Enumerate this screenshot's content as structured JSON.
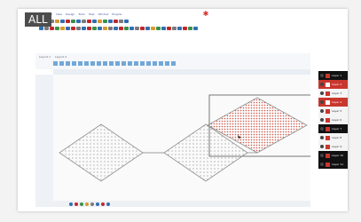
{
  "tag_label": "ALL",
  "brand_icon": "butterfly-logo-icon",
  "menu_items": [
    "File",
    "Edit",
    "View",
    "Design",
    "Tools",
    "Help",
    "Window",
    "Plugins"
  ],
  "tabs": [
    "Layout 1",
    "Layout 2"
  ],
  "colors": {
    "accent_red": "#c9362d",
    "blue": "#3275b8",
    "line": "#8f8f8f"
  },
  "panel_rows": [
    {
      "style": "dark",
      "label": "Layer 1"
    },
    {
      "style": "red",
      "label": "Layer 2"
    },
    {
      "style": "light",
      "label": "Layer 3"
    },
    {
      "style": "red",
      "label": "Layer 4"
    },
    {
      "style": "light",
      "label": "Layer 5"
    },
    {
      "style": "light",
      "label": "Layer 6"
    },
    {
      "style": "dark",
      "label": "Layer 7"
    },
    {
      "style": "light",
      "label": "Layer 8"
    },
    {
      "style": "light",
      "label": "Layer 9"
    },
    {
      "style": "dark",
      "label": "Layer 10"
    },
    {
      "style": "dark",
      "label": "Layer 11"
    }
  ]
}
